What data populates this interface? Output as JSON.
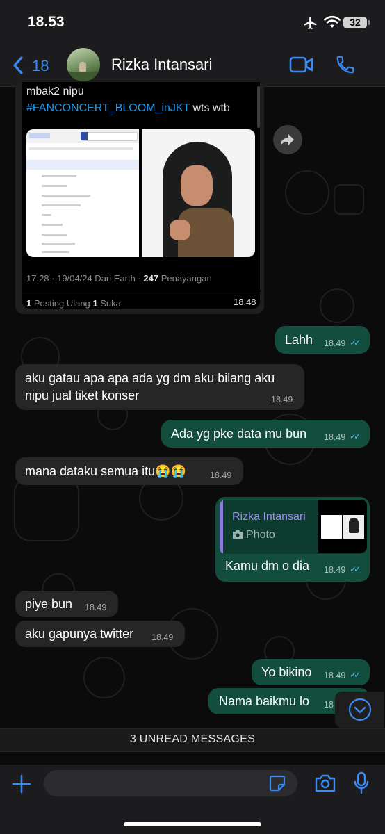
{
  "status_bar": {
    "time": "18.53",
    "battery": "32"
  },
  "header": {
    "back_count": "18",
    "contact_name": "Rizka Intansari"
  },
  "quoted_post": {
    "line1": "mbak2 nipu",
    "hashtag": "#FANCONCERT_BLOOM_inJKT",
    "hashtag_suffix": " wts wtb",
    "meta": "17.28 · 19/04/24 Dari Earth · ",
    "views_count": "247",
    "views_label": " Penayangan",
    "reposts_count": "1",
    "reposts_label": " Posting Ulang ",
    "likes_count": "1",
    "likes_label": " Suka",
    "time": "18.48"
  },
  "messages": [
    {
      "dir": "out",
      "text": "Lahh",
      "time": "18.49"
    },
    {
      "dir": "in",
      "text_line1": "aku gatau apa apa ada yg dm aku bilang aku",
      "text_line2": "nipu jual tiket konser",
      "time": "18.49"
    },
    {
      "dir": "out",
      "text": "Ada yg pke data mu bun",
      "time": "18.49"
    },
    {
      "dir": "in",
      "text": "mana dataku semua itu😭😭",
      "time": "18.49"
    },
    {
      "dir": "out",
      "reply_name": "Rizka Intansari",
      "reply_type": "Photo",
      "text": "Kamu dm o dia",
      "time": "18.49"
    },
    {
      "dir": "in",
      "text": "piye bun",
      "time": "18.49"
    },
    {
      "dir": "in",
      "text": "aku gapunya twitter",
      "time": "18.49"
    },
    {
      "dir": "out",
      "text": "Yo bikino",
      "time": "18.49"
    },
    {
      "dir": "out",
      "text": "Nama baikmu lo",
      "time": "18"
    }
  ],
  "unread_banner": "3 UNREAD MESSAGES",
  "colors": {
    "accent": "#3b8bf5",
    "outgoing": "#134d3d",
    "incoming": "#262626",
    "read_tick": "#53bdeb"
  },
  "icons": [
    "airplane-icon",
    "wifi-icon",
    "back-chevron-icon",
    "video-call-icon",
    "voice-call-icon",
    "forward-icon",
    "camera-icon",
    "plus-icon",
    "sticker-icon",
    "microphone-icon",
    "scroll-down-icon"
  ]
}
